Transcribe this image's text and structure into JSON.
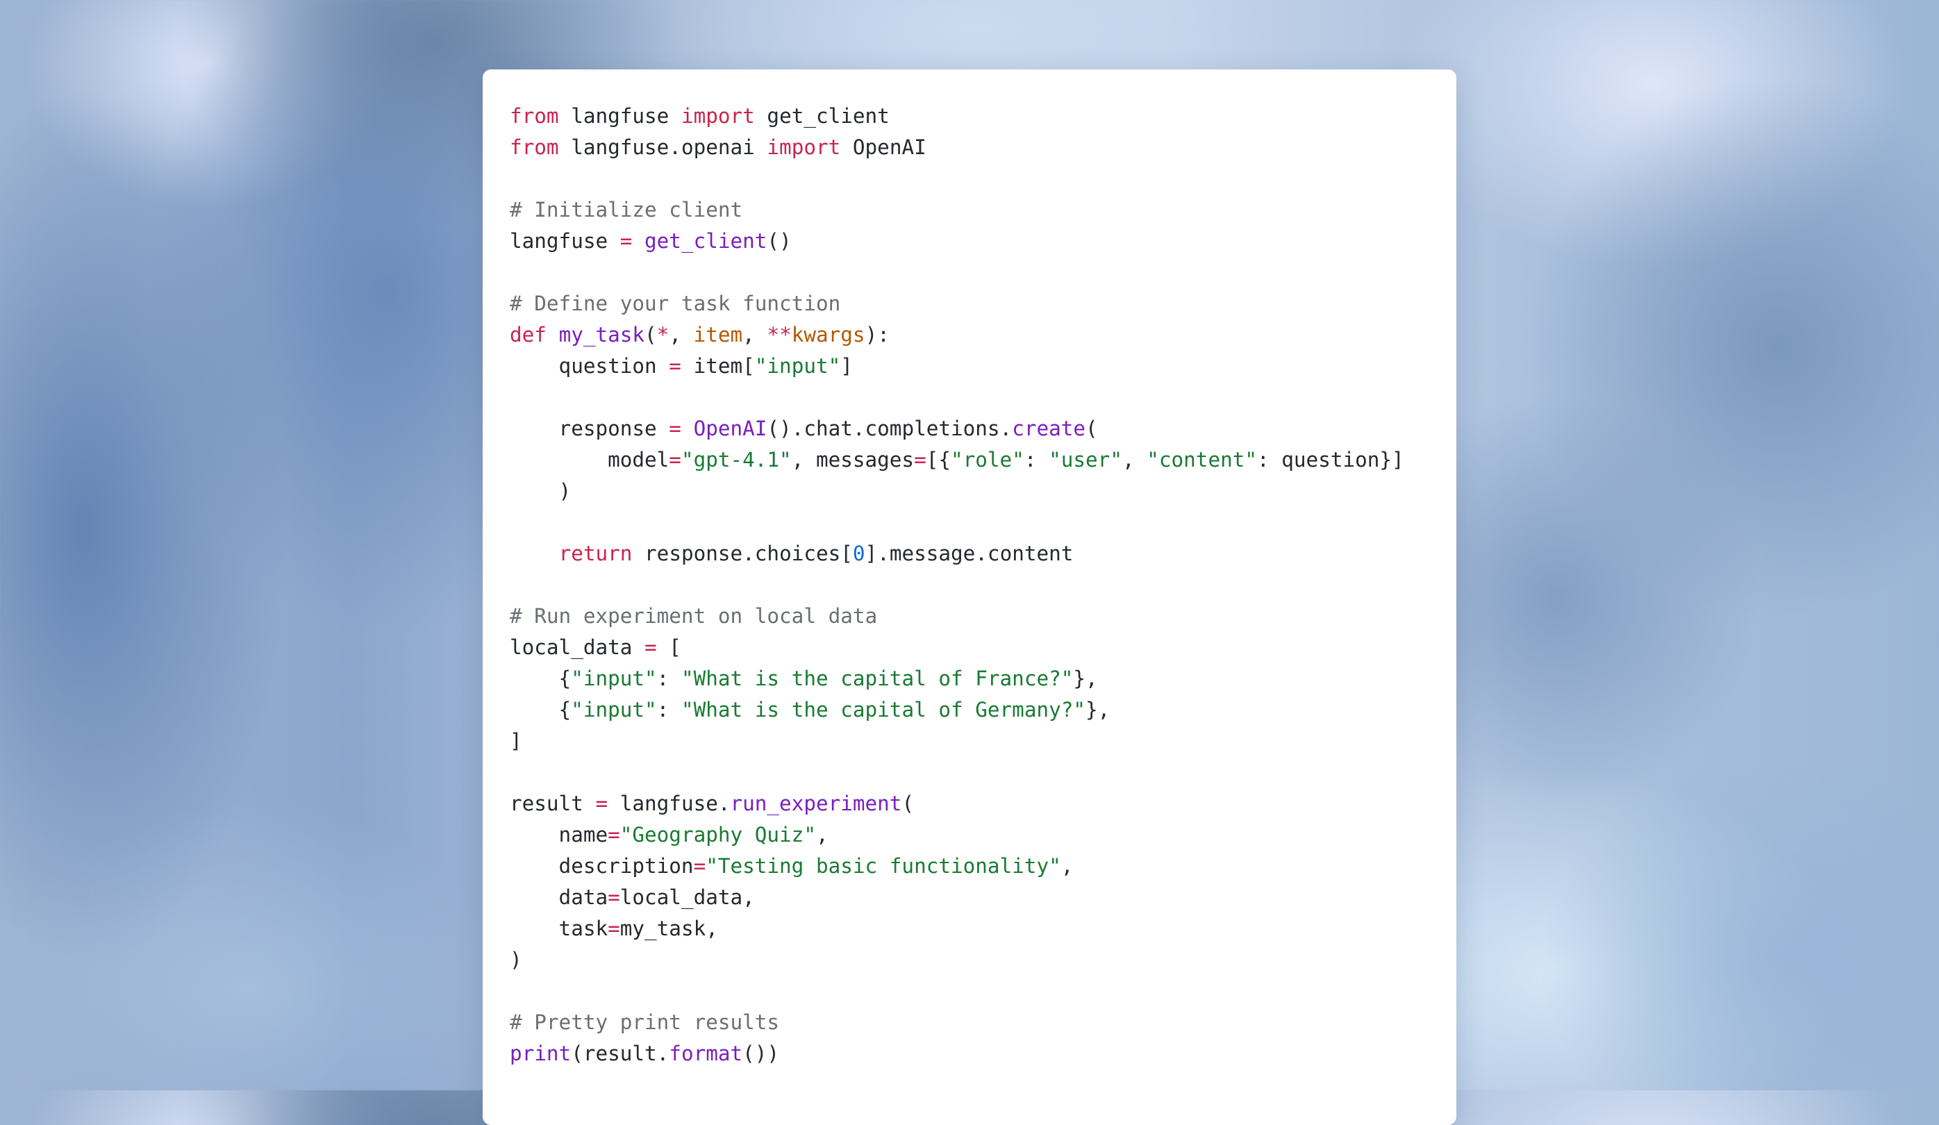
{
  "code_lines": [
    [
      {
        "t": "from",
        "c": "k"
      },
      {
        "t": " langfuse ",
        "c": "t"
      },
      {
        "t": "import",
        "c": "k"
      },
      {
        "t": " get_client",
        "c": "t"
      }
    ],
    [
      {
        "t": "from",
        "c": "k"
      },
      {
        "t": " langfuse.openai ",
        "c": "t"
      },
      {
        "t": "import",
        "c": "k"
      },
      {
        "t": " OpenAI",
        "c": "t"
      }
    ],
    [],
    [
      {
        "t": "# Initialize client",
        "c": "c"
      }
    ],
    [
      {
        "t": "langfuse ",
        "c": "t"
      },
      {
        "t": "=",
        "c": "k"
      },
      {
        "t": " ",
        "c": "t"
      },
      {
        "t": "get_client",
        "c": "f"
      },
      {
        "t": "()",
        "c": "t"
      }
    ],
    [],
    [
      {
        "t": "# Define your task function",
        "c": "c"
      }
    ],
    [
      {
        "t": "def",
        "c": "k"
      },
      {
        "t": " ",
        "c": "t"
      },
      {
        "t": "my_task",
        "c": "f"
      },
      {
        "t": "(",
        "c": "t"
      },
      {
        "t": "*",
        "c": "k"
      },
      {
        "t": ", ",
        "c": "t"
      },
      {
        "t": "item",
        "c": "p"
      },
      {
        "t": ", ",
        "c": "t"
      },
      {
        "t": "**",
        "c": "k"
      },
      {
        "t": "kwargs",
        "c": "p"
      },
      {
        "t": "):",
        "c": "t"
      }
    ],
    [
      {
        "t": "    question ",
        "c": "t"
      },
      {
        "t": "=",
        "c": "k"
      },
      {
        "t": " item[",
        "c": "t"
      },
      {
        "t": "\"input\"",
        "c": "s"
      },
      {
        "t": "]",
        "c": "t"
      }
    ],
    [],
    [
      {
        "t": "    response ",
        "c": "t"
      },
      {
        "t": "=",
        "c": "k"
      },
      {
        "t": " ",
        "c": "t"
      },
      {
        "t": "OpenAI",
        "c": "f"
      },
      {
        "t": "().chat.completions.",
        "c": "t"
      },
      {
        "t": "create",
        "c": "f"
      },
      {
        "t": "(",
        "c": "t"
      }
    ],
    [
      {
        "t": "        model",
        "c": "t"
      },
      {
        "t": "=",
        "c": "k"
      },
      {
        "t": "\"gpt-4.1\"",
        "c": "s"
      },
      {
        "t": ", messages",
        "c": "t"
      },
      {
        "t": "=",
        "c": "k"
      },
      {
        "t": "[{",
        "c": "t"
      },
      {
        "t": "\"role\"",
        "c": "s"
      },
      {
        "t": ": ",
        "c": "t"
      },
      {
        "t": "\"user\"",
        "c": "s"
      },
      {
        "t": ", ",
        "c": "t"
      },
      {
        "t": "\"content\"",
        "c": "s"
      },
      {
        "t": ": question}]",
        "c": "t"
      }
    ],
    [
      {
        "t": "    )",
        "c": "t"
      }
    ],
    [],
    [
      {
        "t": "    ",
        "c": "t"
      },
      {
        "t": "return",
        "c": "k"
      },
      {
        "t": " response.choices[",
        "c": "t"
      },
      {
        "t": "0",
        "c": "n"
      },
      {
        "t": "].message.content",
        "c": "t"
      }
    ],
    [],
    [
      {
        "t": "# Run experiment on local data",
        "c": "c"
      }
    ],
    [
      {
        "t": "local_data ",
        "c": "t"
      },
      {
        "t": "=",
        "c": "k"
      },
      {
        "t": " [",
        "c": "t"
      }
    ],
    [
      {
        "t": "    {",
        "c": "t"
      },
      {
        "t": "\"input\"",
        "c": "s"
      },
      {
        "t": ": ",
        "c": "t"
      },
      {
        "t": "\"What is the capital of France?\"",
        "c": "s"
      },
      {
        "t": "},",
        "c": "t"
      }
    ],
    [
      {
        "t": "    {",
        "c": "t"
      },
      {
        "t": "\"input\"",
        "c": "s"
      },
      {
        "t": ": ",
        "c": "t"
      },
      {
        "t": "\"What is the capital of Germany?\"",
        "c": "s"
      },
      {
        "t": "},",
        "c": "t"
      }
    ],
    [
      {
        "t": "]",
        "c": "t"
      }
    ],
    [],
    [
      {
        "t": "result ",
        "c": "t"
      },
      {
        "t": "=",
        "c": "k"
      },
      {
        "t": " langfuse.",
        "c": "t"
      },
      {
        "t": "run_experiment",
        "c": "f"
      },
      {
        "t": "(",
        "c": "t"
      }
    ],
    [
      {
        "t": "    name",
        "c": "t"
      },
      {
        "t": "=",
        "c": "k"
      },
      {
        "t": "\"Geography Quiz\"",
        "c": "s"
      },
      {
        "t": ",",
        "c": "t"
      }
    ],
    [
      {
        "t": "    description",
        "c": "t"
      },
      {
        "t": "=",
        "c": "k"
      },
      {
        "t": "\"Testing basic functionality\"",
        "c": "s"
      },
      {
        "t": ",",
        "c": "t"
      }
    ],
    [
      {
        "t": "    data",
        "c": "t"
      },
      {
        "t": "=",
        "c": "k"
      },
      {
        "t": "local_data,",
        "c": "t"
      }
    ],
    [
      {
        "t": "    task",
        "c": "t"
      },
      {
        "t": "=",
        "c": "k"
      },
      {
        "t": "my_task,",
        "c": "t"
      }
    ],
    [
      {
        "t": ")",
        "c": "t"
      }
    ],
    [],
    [
      {
        "t": "# Pretty print results",
        "c": "c"
      }
    ],
    [
      {
        "t": "print",
        "c": "f"
      },
      {
        "t": "(result.",
        "c": "t"
      },
      {
        "t": "format",
        "c": "f"
      },
      {
        "t": "())",
        "c": "t"
      }
    ]
  ]
}
